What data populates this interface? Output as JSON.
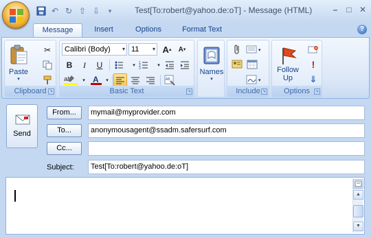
{
  "window": {
    "title": "Test[To:robert@yahoo.de:oT] - Message (HTML)",
    "min_label": "–",
    "max_label": "□",
    "close_label": "✕"
  },
  "quick_access": [
    "save-icon",
    "undo-icon",
    "redo-icon",
    "up-icon",
    "down-icon",
    "customize-icon"
  ],
  "tabs": [
    {
      "label": "Message",
      "active": true
    },
    {
      "label": "Insert",
      "active": false
    },
    {
      "label": "Options",
      "active": false
    },
    {
      "label": "Format Text",
      "active": false
    }
  ],
  "ribbon": {
    "clipboard": {
      "label": "Clipboard",
      "paste_label": "Paste"
    },
    "basic_text": {
      "label": "Basic Text",
      "font_name": "Calibri (Body)",
      "font_size": "11",
      "bold": "B",
      "italic": "I",
      "underline": "U",
      "highlight_text": "ab",
      "font_color_text": "A"
    },
    "names": {
      "label": "Names"
    },
    "include": {
      "label": "Include"
    },
    "options": {
      "label": "Options",
      "follow_up_label": "Follow\nUp"
    }
  },
  "compose": {
    "send_label": "Send",
    "from_label": "From...",
    "from_value": "mymail@myprovider.com",
    "to_label": "To...",
    "to_value": "anonymousagent@ssadm.safersurf.com",
    "cc_label": "Cc...",
    "cc_value": "",
    "subject_label": "Subject:",
    "subject_value": "Test[To:robert@yahoo.de:oT]",
    "body_value": ""
  },
  "colors": {
    "highlight": "#ffff00",
    "font_color": "#c00000",
    "follow_up_flag": "#e04a1a"
  }
}
